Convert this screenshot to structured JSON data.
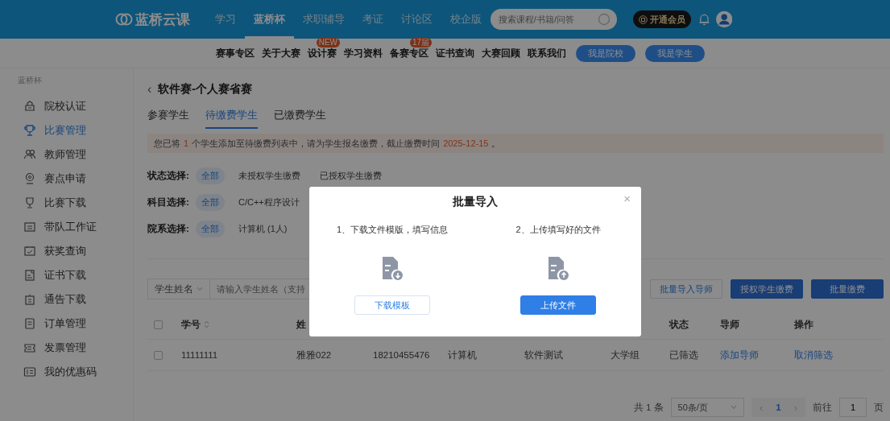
{
  "top_nav": {
    "logo": "蓝桥云课",
    "tabs": [
      {
        "label": "学习",
        "selected": false
      },
      {
        "label": "蓝桥杯",
        "selected": true
      },
      {
        "label": "求职辅导",
        "selected": false
      },
      {
        "label": "考证",
        "selected": false
      },
      {
        "label": "讨论区",
        "selected": false
      },
      {
        "label": "校企版",
        "selected": false
      }
    ],
    "search": {
      "placeholder": "搜索课程/书籍/问答"
    },
    "vip_button": "开通会员"
  },
  "sub_nav": {
    "links": [
      {
        "label": "赛事专区"
      },
      {
        "label": "关于大赛"
      },
      {
        "label": "设计赛",
        "badge": "NEW"
      },
      {
        "label": "学习资料"
      },
      {
        "label": "备赛专区",
        "badge": "17届"
      },
      {
        "label": "证书查询"
      },
      {
        "label": "大赛回顾"
      },
      {
        "label": "联系我们"
      }
    ],
    "buttons": [
      "我是院校",
      "我是学生"
    ]
  },
  "sidebar": {
    "heading": "蓝桥杯",
    "items": [
      {
        "label": "院校认证",
        "selected": false
      },
      {
        "label": "比赛管理",
        "selected": true
      },
      {
        "label": "教师管理",
        "selected": false
      },
      {
        "label": "赛点申请",
        "selected": false
      },
      {
        "label": "比赛下载",
        "selected": false
      },
      {
        "label": "带队工作证",
        "selected": false
      },
      {
        "label": "获奖查询",
        "selected": false
      },
      {
        "label": "证书下载",
        "selected": false
      },
      {
        "label": "通告下载",
        "selected": false
      },
      {
        "label": "订单管理",
        "selected": false
      },
      {
        "label": "发票管理",
        "selected": false
      },
      {
        "label": "我的优惠码",
        "selected": false
      }
    ]
  },
  "page": {
    "back": "‹",
    "title": "软件赛-个人赛省赛",
    "tabs": [
      {
        "label": "参赛学生",
        "selected": false
      },
      {
        "label": "待缴费学生",
        "selected": true
      },
      {
        "label": "已缴费学生",
        "selected": false
      }
    ],
    "notice": "您已将 **1** 个学生添加至待缴费列表中，请为学生报名缴费，截止缴费时间 **2025-12-15** 。",
    "filters": [
      {
        "label": "状态选择:",
        "options": [
          {
            "label": "全部",
            "selected": true
          },
          {
            "label": "未授权学生缴费",
            "selected": false
          },
          {
            "label": "已授权学生缴费",
            "selected": false
          }
        ]
      },
      {
        "label": "科目选择:",
        "options": [
          {
            "label": "全部",
            "selected": true
          },
          {
            "label": "C/C++程序设计",
            "selected": false
          }
        ]
      },
      {
        "label": "院系选择:",
        "options": [
          {
            "label": "全部",
            "selected": true
          },
          {
            "label": "计算机 (1人)",
            "selected": false
          }
        ]
      }
    ],
    "search_type": "学生姓名",
    "search": {
      "placeholder": "请输入学生姓名（支持"
    },
    "buttons": [
      {
        "label": "批量导入导师",
        "kind": "outline"
      },
      {
        "label": "授权学生缴费",
        "kind": "primary"
      },
      {
        "label": "批量缴费",
        "kind": "primary"
      }
    ],
    "table": {
      "all_checked": false,
      "columns": [
        {
          "label": "学号",
          "sortable": true
        },
        {
          "label": "姓"
        },
        null,
        null,
        null,
        null,
        {
          "label": "状态"
        },
        {
          "label": "导师"
        },
        {
          "label": "操作"
        }
      ],
      "rows": [
        {
          "checked": false,
          "cells": [
            {
              "text": "11111111"
            },
            {
              "text": "雅雅022"
            },
            {
              "text": "18210455476"
            },
            {
              "text": "计算机"
            },
            {
              "text": "软件测试"
            },
            {
              "text": "大学组"
            },
            {
              "text": "已筛选"
            },
            {
              "text": "添加导师",
              "kind": "link"
            },
            {
              "text": "取消筛选",
              "kind": "link"
            }
          ]
        }
      ]
    },
    "pagination": {
      "total": "共 1 条",
      "page_size": "50条/页",
      "prev": "‹",
      "pages": [
        {
          "label": "1",
          "selected": true
        }
      ],
      "next": "›",
      "goto_label": "前往",
      "goto_value": "1",
      "goto_suffix": "页"
    }
  },
  "dialog": {
    "title": "批量导入",
    "close": "×",
    "steps": [
      {
        "text": "1、下载文件模版，填写信息",
        "kind": "download",
        "button": "下载模板"
      },
      {
        "text": "2、上传填写好的文件",
        "kind": "upload",
        "button": "上传文件"
      }
    ]
  }
}
